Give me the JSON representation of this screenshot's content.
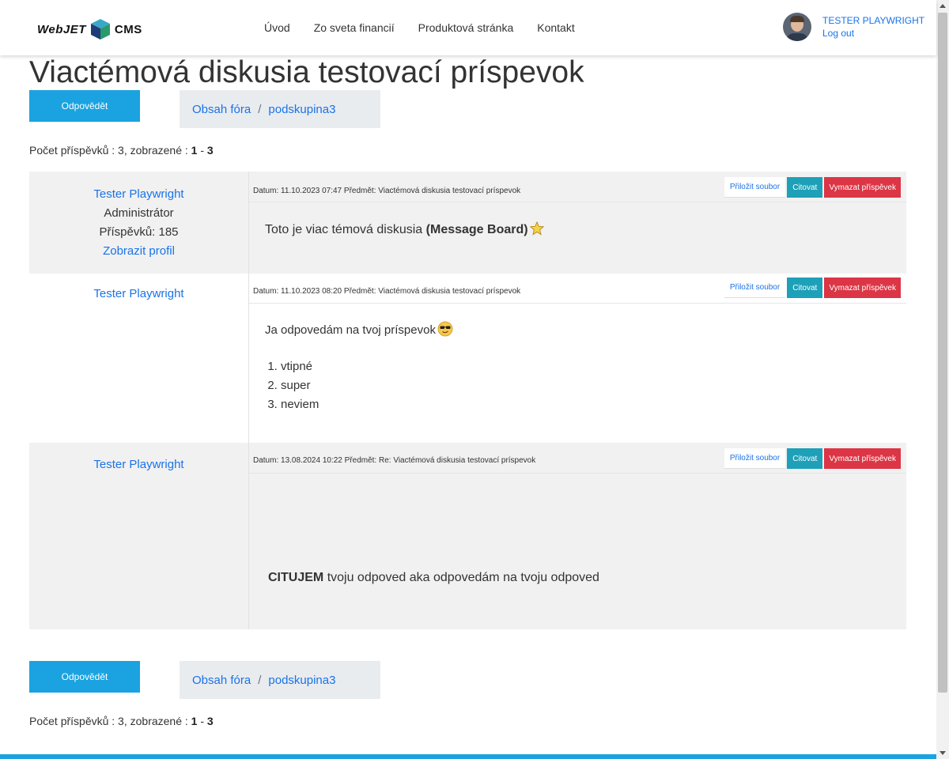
{
  "header": {
    "logo_text": "WebJET",
    "logo_cms": "CMS",
    "nav": [
      "Úvod",
      "Zo sveta financií",
      "Produktová stránka",
      "Kontakt"
    ],
    "user_name": "TESTER PLAYWRIGHT",
    "logout_label": "Log out"
  },
  "page": {
    "title": "Viactémová diskusia testovací príspevok",
    "reply_label": "Odpovědět",
    "breadcrumb": [
      "Obsah fóra",
      "podskupina3"
    ],
    "breadcrumb_sep": "/",
    "count_prefix": "Počet příspěvků : 3, zobrazené :",
    "count_from": "1",
    "count_dash": "-",
    "count_to": "3"
  },
  "posts": [
    {
      "author": "Tester Playwright",
      "role": "Administrátor",
      "post_count": "Příspěvků: 185",
      "profile_link": "Zobrazit profil",
      "meta": "Datum: 11.10.2023 07:47 Předmět: Viactémová diskusia testovací príspevok",
      "body_text": "Toto je viac témová diskusia",
      "body_bold": "(Message Board)"
    },
    {
      "author": "Tester Playwright",
      "meta": "Datum: 11.10.2023 08:20 Předmět: Viactémová diskusia testovací príspevok",
      "body_text": "Ja odpovedám na tvoj príspevok",
      "list": [
        "vtipné",
        "super",
        "neviem"
      ]
    },
    {
      "author": "Tester Playwright",
      "meta": "Datum: 13.08.2024 10:22 Předmět: Re: Viactémová diskusia testovací príspevok",
      "body_bold": "CITUJEM",
      "body_text": "tvoju odpoved aka odpovedám na tvoju odpoved"
    }
  ],
  "actions": {
    "attach": "Přiložit soubor",
    "quote": "Citovat",
    "delete": "Vymazat příspěvek"
  },
  "colors": {
    "accent": "#1aa3e0",
    "link": "#1a73e8",
    "quote": "#1ea0b8",
    "delete": "#dc3545"
  }
}
